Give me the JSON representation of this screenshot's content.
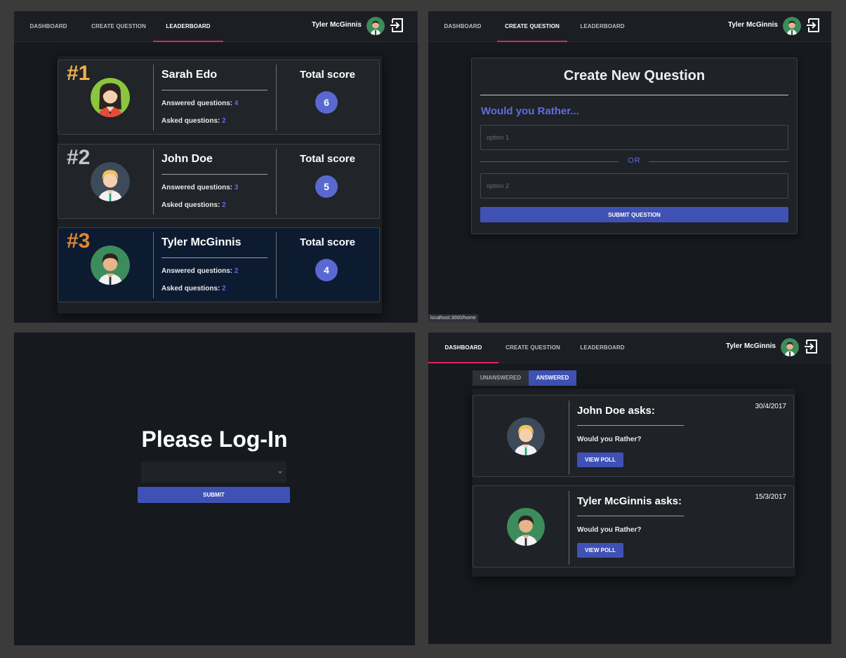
{
  "nav": {
    "tabs": [
      "DASHBOARD",
      "CREATE QUESTION",
      "LEADERBOARD"
    ],
    "user_name": "Tyler McGinnis",
    "logout_icon": "logout-icon"
  },
  "leaderboard": {
    "score_label": "Total score",
    "answered_label": "Answered questions:",
    "asked_label": "Asked questions:",
    "entries": [
      {
        "rank": "#1",
        "name": "Sarah Edo",
        "answered": "4",
        "asked": "2",
        "score": "6",
        "rank_color": "#f0b04a",
        "avatar": "female-avatar-icon"
      },
      {
        "rank": "#2",
        "name": "John Doe",
        "answered": "3",
        "asked": "2",
        "score": "5",
        "rank_color": "#c2c4c8",
        "avatar": "blond-male-avatar-icon"
      },
      {
        "rank": "#3",
        "name": "Tyler McGinnis",
        "answered": "2",
        "asked": "2",
        "score": "4",
        "rank_color": "#e0882f",
        "avatar": "dark-hair-male-avatar-icon"
      }
    ]
  },
  "create_question": {
    "title": "Create New Question",
    "subtitle": "Would you Rather...",
    "option1_placeholder": "option 1",
    "or_label": "OR",
    "option2_placeholder": "option 2",
    "submit_label": "SUBMIT QUESTION",
    "status_url": "localhost:3000/home"
  },
  "login": {
    "title": "Please Log-In",
    "select_value": "",
    "submit_label": "SUBMIT"
  },
  "dashboard": {
    "toggle": [
      "UNANSWERED",
      "ANSWERED"
    ],
    "active_toggle": "ANSWERED",
    "view_poll_label": "VIEW POLL",
    "polls": [
      {
        "asker": "John Doe asks:",
        "question": "Would you Rather?",
        "date": "30/4/2017",
        "avatar": "blond-male-avatar-icon"
      },
      {
        "asker": "Tyler McGinnis asks:",
        "question": "Would you Rather?",
        "date": "15/3/2017",
        "avatar": "dark-hair-male-avatar-icon"
      }
    ]
  },
  "colors": {
    "accent": "#3f51b5",
    "tab_underline": "#e0245e",
    "link_number": "#5c6ee0"
  }
}
